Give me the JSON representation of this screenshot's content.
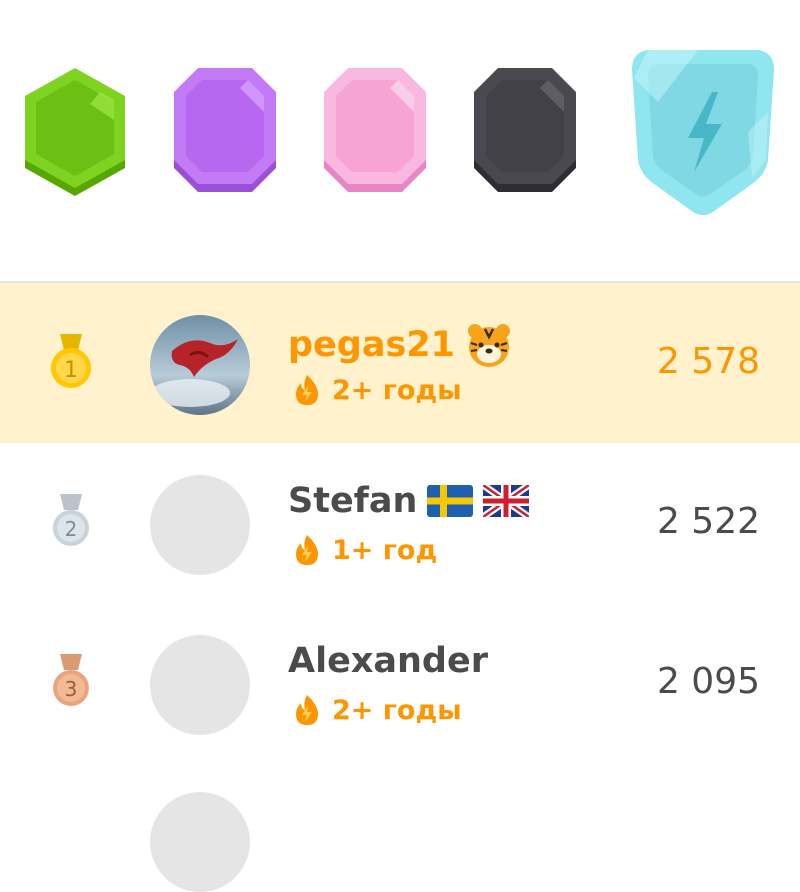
{
  "league_badges": [
    {
      "name": "green-league-badge",
      "color": "#7ed321"
    },
    {
      "name": "purple-league-badge",
      "color": "#c27bf5"
    },
    {
      "name": "pink-league-badge",
      "color": "#f8a6d8"
    },
    {
      "name": "dark-league-badge",
      "color": "#4a4950"
    },
    {
      "name": "diamond-league-badge",
      "color": "#8fe6ef",
      "icon": "lightning-icon"
    }
  ],
  "leaderboard": [
    {
      "rank": "1",
      "medal": "gold",
      "username": "pegas21",
      "extra_icon": "tiger-emoji",
      "streak_label": "2+ годы",
      "xp": "2 578",
      "highlighted": true
    },
    {
      "rank": "2",
      "medal": "silver",
      "username": "Stefan",
      "extra_icon": "sweden-flag uk-flag",
      "streak_label": "1+ год",
      "xp": "2 522",
      "highlighted": false
    },
    {
      "rank": "3",
      "medal": "bronze",
      "username": "Alexander",
      "extra_icon": "",
      "streak_label": "2+ годы",
      "xp": "2 095",
      "highlighted": false
    }
  ],
  "colors": {
    "accent_orange": "#ff9600",
    "highlight_row": "#fff2cc",
    "text_dark": "#4b4b4b"
  }
}
